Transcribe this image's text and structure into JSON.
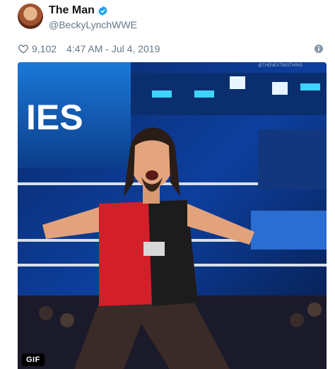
{
  "tweet": {
    "author_name": "The Man",
    "handle": "@BeckyLynchWWE",
    "likes": "9,102",
    "timestamp": "4:47 AM - Jul 4, 2019",
    "media": {
      "badge": "GIF",
      "sign_text": "IES",
      "watermark": "@THENEXTBIGTHING"
    }
  }
}
